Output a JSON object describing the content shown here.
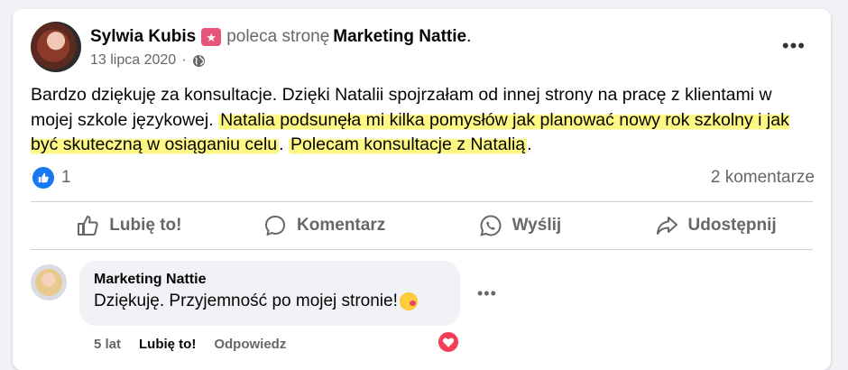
{
  "post": {
    "author": "Sylwia Kubis",
    "recommend_icon": "recommend-star-badge",
    "recommend_text": "poleca stronę",
    "page_name": "Marketing Nattie",
    "page_name_suffix": ".",
    "date": "13 lipca 2020",
    "date_separator": "·",
    "privacy_icon": "globe-icon",
    "more_label": "•••",
    "text_plain_1": "Bardzo dziękuję za konsultacje. Dzięki Natalii spojrzałam od innej strony na pracę z klientami w mojej szkole językowej. ",
    "text_highlight_1": "Natalia podsunęła mi kilka pomysłów jak planować nowy rok szkolny i jak być skuteczną w osiąganiu celu",
    "text_plain_2": ". ",
    "text_highlight_2": "Polecam konsultacje z Natalią",
    "text_plain_3": ".",
    "highlight_color": "#fdf66e",
    "reactions_count": "1",
    "reaction_icon": "thumbs-up-icon",
    "comments_count": "2 komentarze"
  },
  "actions": {
    "like": "Lubię to!",
    "comment": "Komentarz",
    "send": "Wyślij",
    "share": "Udostępnij"
  },
  "comment": {
    "author": "Marketing Nattie",
    "text": "Dziękuję. Przyjemność po mojej stronie!",
    "emoji": "blush-emoji",
    "more_label": "•••",
    "age": "5 lat",
    "like_label": "Lubię to!",
    "reply_label": "Odpowiedz",
    "reaction_icon": "heart-icon"
  },
  "colors": {
    "brand_blue": "#1877f2",
    "heart_red": "#f33e58",
    "secondary_text": "#65676b"
  }
}
